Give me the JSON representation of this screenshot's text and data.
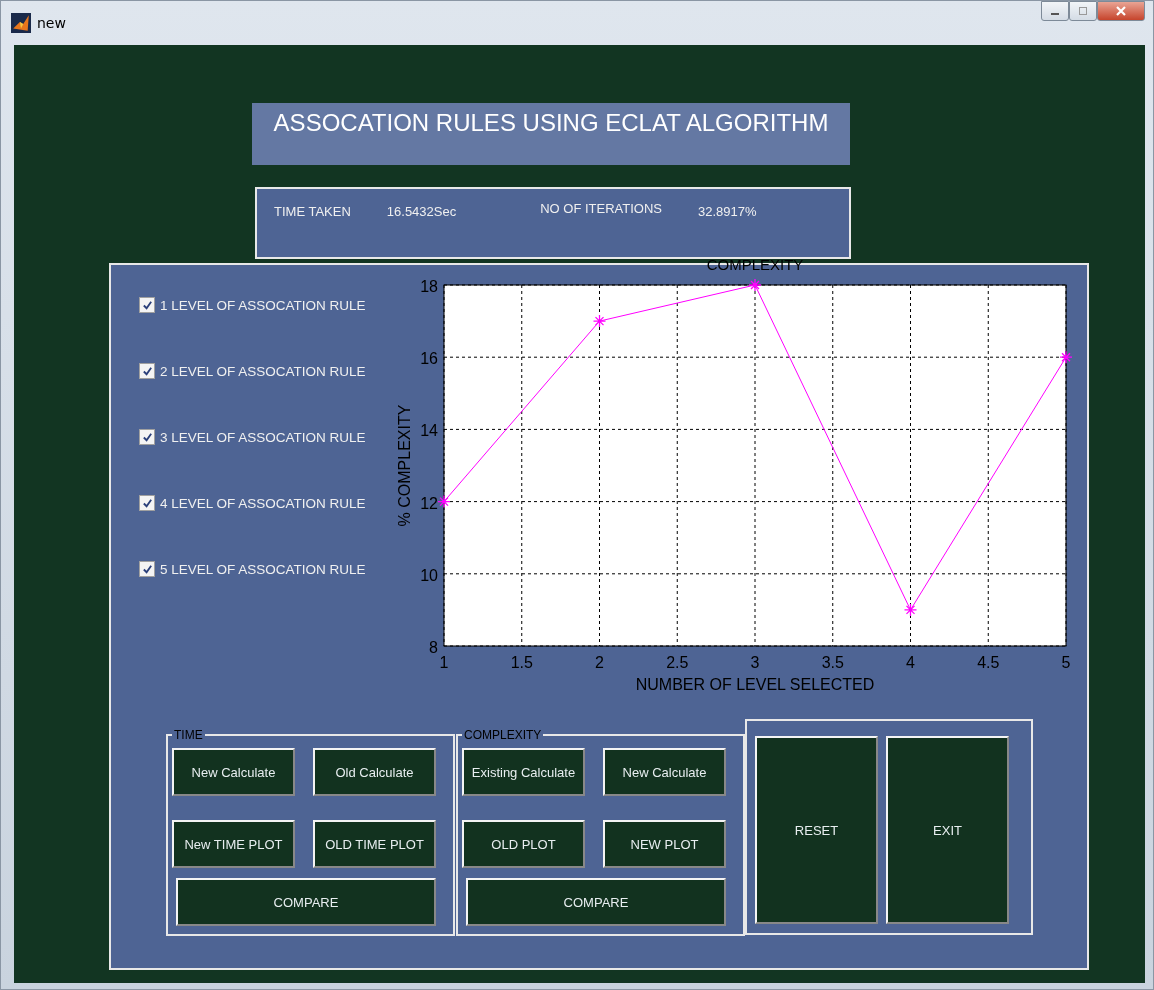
{
  "window": {
    "title": "new"
  },
  "header": {
    "title": "ASSOCATION RULES USING ECLAT ALGORITHM"
  },
  "stats": [
    {
      "label": "TIME TAKEN",
      "value": "16.5432Sec"
    },
    {
      "label": "NO OF ITERATIONS",
      "value": "32.8917%"
    }
  ],
  "options": [
    {
      "label": "1 LEVEL OF ASSOCATION RULE",
      "checked": true
    },
    {
      "label": "2 LEVEL OF ASSOCATION RULE",
      "checked": true
    },
    {
      "label": "3 LEVEL OF ASSOCATION RULE",
      "checked": true
    },
    {
      "label": "4 LEVEL OF ASSOCATION RULE",
      "checked": true
    },
    {
      "label": "5 LEVEL OF ASSOCATION RULE",
      "checked": true
    }
  ],
  "chart_data": {
    "type": "line",
    "title": "COMPLEXITY",
    "xlabel": "NUMBER OF LEVEL SELECTED",
    "ylabel": "% COMPLEXITY",
    "x": [
      1,
      2,
      3,
      4,
      5
    ],
    "series": [
      {
        "color": "#ff00ff",
        "marker": "cross",
        "values": [
          12,
          17,
          18,
          9,
          16
        ]
      }
    ],
    "grid": true,
    "xlim": [
      1,
      5
    ],
    "ylim": [
      8,
      18
    ],
    "xticks": [
      1,
      1.5,
      2,
      2.5,
      3,
      3.5,
      4,
      4.5,
      5
    ],
    "yticks": [
      8,
      10,
      12,
      14,
      16,
      18
    ]
  },
  "groups": [
    {
      "title": "TIME",
      "buttons": [
        {
          "label": "New Calculate",
          "kind": "normal"
        },
        {
          "label": "Old Calculate",
          "kind": "normal"
        },
        {
          "label": "New TIME PLOT",
          "kind": "normal"
        },
        {
          "label": "OLD TIME PLOT",
          "kind": "normal"
        },
        {
          "label": "COMPARE",
          "kind": "wide"
        }
      ]
    },
    {
      "title": "COMPLEXITY",
      "buttons": [
        {
          "label": "Existing Calculate",
          "kind": "normal"
        },
        {
          "label": "New Calculate",
          "kind": "normal"
        },
        {
          "label": "OLD  PLOT",
          "kind": "normal"
        },
        {
          "label": "NEW  PLOT",
          "kind": "normal"
        },
        {
          "label": "COMPARE",
          "kind": "wide"
        }
      ]
    }
  ],
  "actions": [
    {
      "label": "RESET"
    },
    {
      "label": "EXIT"
    }
  ]
}
